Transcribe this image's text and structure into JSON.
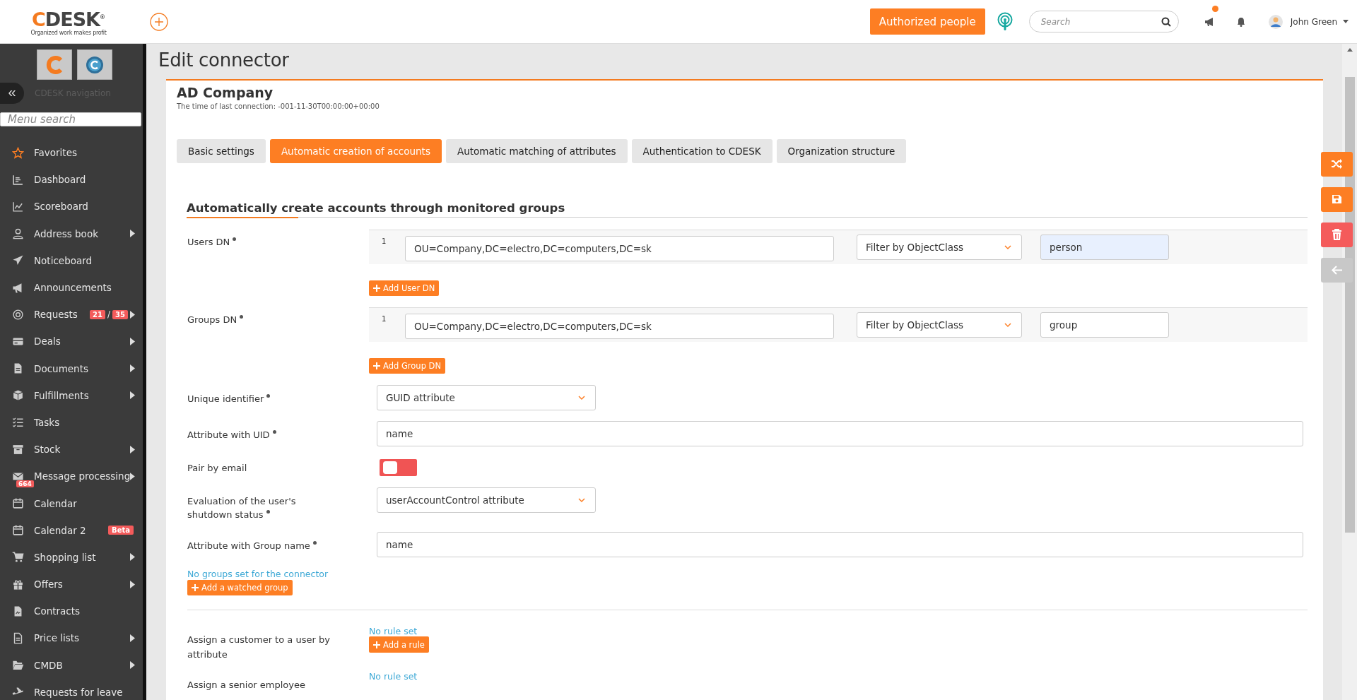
{
  "header": {
    "logo": "CDESK$^{®}$",
    "tagline": "Organized work makes profit",
    "authorized_button": "Authorized people",
    "search": {
      "placeholder": "Search"
    },
    "notification_dot": true,
    "user": "John Green"
  },
  "sidebar": {
    "collapse": "«",
    "title": "CDESK navigation",
    "search": {
      "placeholder": "Menu search"
    },
    "items": [
      {
        "label": "Favorites",
        "submenu": false
      },
      {
        "label": "Dashboard",
        "submenu": false
      },
      {
        "label": "Scoreboard",
        "submenu": false
      },
      {
        "label": "Address book",
        "submenu": true
      },
      {
        "label": "Noticeboard",
        "submenu": false
      },
      {
        "label": "Announcements",
        "submenu": false
      },
      {
        "label": "Requests",
        "submenu": true,
        "badges": [
          "21",
          "35"
        ],
        "badge_separator": "/"
      },
      {
        "label": "Deals",
        "submenu": true
      },
      {
        "label": "Documents",
        "submenu": true
      },
      {
        "label": "Fulfillments",
        "submenu": true
      },
      {
        "label": "Tasks",
        "submenu": false
      },
      {
        "label": "Stock",
        "submenu": true
      },
      {
        "label": "Message processing",
        "submenu": true,
        "icon_badge": "664"
      },
      {
        "label": "Calendar",
        "submenu": false
      },
      {
        "label": "Calendar 2",
        "submenu": false,
        "tag": "Beta"
      },
      {
        "label": "Shopping list",
        "submenu": true
      },
      {
        "label": "Offers",
        "submenu": true
      },
      {
        "label": "Contracts",
        "submenu": false
      },
      {
        "label": "Price lists",
        "submenu": true
      },
      {
        "label": "CMDB",
        "submenu": true
      },
      {
        "label": "Requests for leave",
        "submenu": false
      }
    ]
  },
  "page": {
    "title": "Edit connector",
    "connector": {
      "name": "AD Company",
      "last_connection": "The time of last connection: -001-11-30T00:00:00+00:00"
    },
    "tabs": [
      {
        "label": "Basic settings",
        "selected": false
      },
      {
        "label": "Automatic creation of accounts",
        "selected": true
      },
      {
        "label": "Automatic matching of attributes",
        "selected": false
      },
      {
        "label": "Authentication to CDESK",
        "selected": false
      },
      {
        "label": "Organization structure",
        "selected": false
      }
    ],
    "section_title": "Automatically create accounts through monitored groups",
    "rows": [
      {
        "kind": "dn_list",
        "label": "Users DN",
        "required": true,
        "entries": [
          {
            "index": "1",
            "dn": "OU=Company,DC=electro,DC=computers,DC=sk",
            "filter": "Filter by ObjectClass",
            "value": "person",
            "autofilled": true
          }
        ],
        "add_button": "Add User DN"
      },
      {
        "kind": "dn_list",
        "label": "Groups DN",
        "required": true,
        "entries": [
          {
            "index": "1",
            "dn": "OU=Company,DC=electro,DC=computers,DC=sk",
            "filter": "Filter by ObjectClass",
            "value": "group",
            "autofilled": false
          }
        ],
        "add_button": "Add Group DN"
      },
      {
        "kind": "select",
        "label": "Unique identifier",
        "required": true,
        "value": "GUID attribute"
      },
      {
        "kind": "text",
        "label": "Attribute with UID",
        "required": true,
        "value": "name"
      },
      {
        "kind": "toggle",
        "label": "Pair by email",
        "on": false
      },
      {
        "kind": "select",
        "label": "Evaluation of the user's shutdown status",
        "required": true,
        "value": "userAccountControl attribute"
      },
      {
        "kind": "text",
        "label": "Attribute with Group name",
        "required": true,
        "value": "name"
      },
      {
        "kind": "groups",
        "status": "No groups set for the connector",
        "add_button": "Add a watched group"
      },
      {
        "kind": "divider"
      },
      {
        "kind": "rule",
        "label": "Assign a customer to a user by attribute",
        "status": "No rule set",
        "add_button": "Add a rule"
      },
      {
        "kind": "rule",
        "label": "Assign a senior employee",
        "status": "No rule set"
      }
    ]
  },
  "actions": [
    {
      "kind": "shuffle",
      "color": "#fd7e23"
    },
    {
      "kind": "save",
      "color": "#fd7e23"
    },
    {
      "kind": "delete",
      "color": "#f45b5b"
    },
    {
      "kind": "back",
      "color": "#c8c8c8"
    }
  ]
}
